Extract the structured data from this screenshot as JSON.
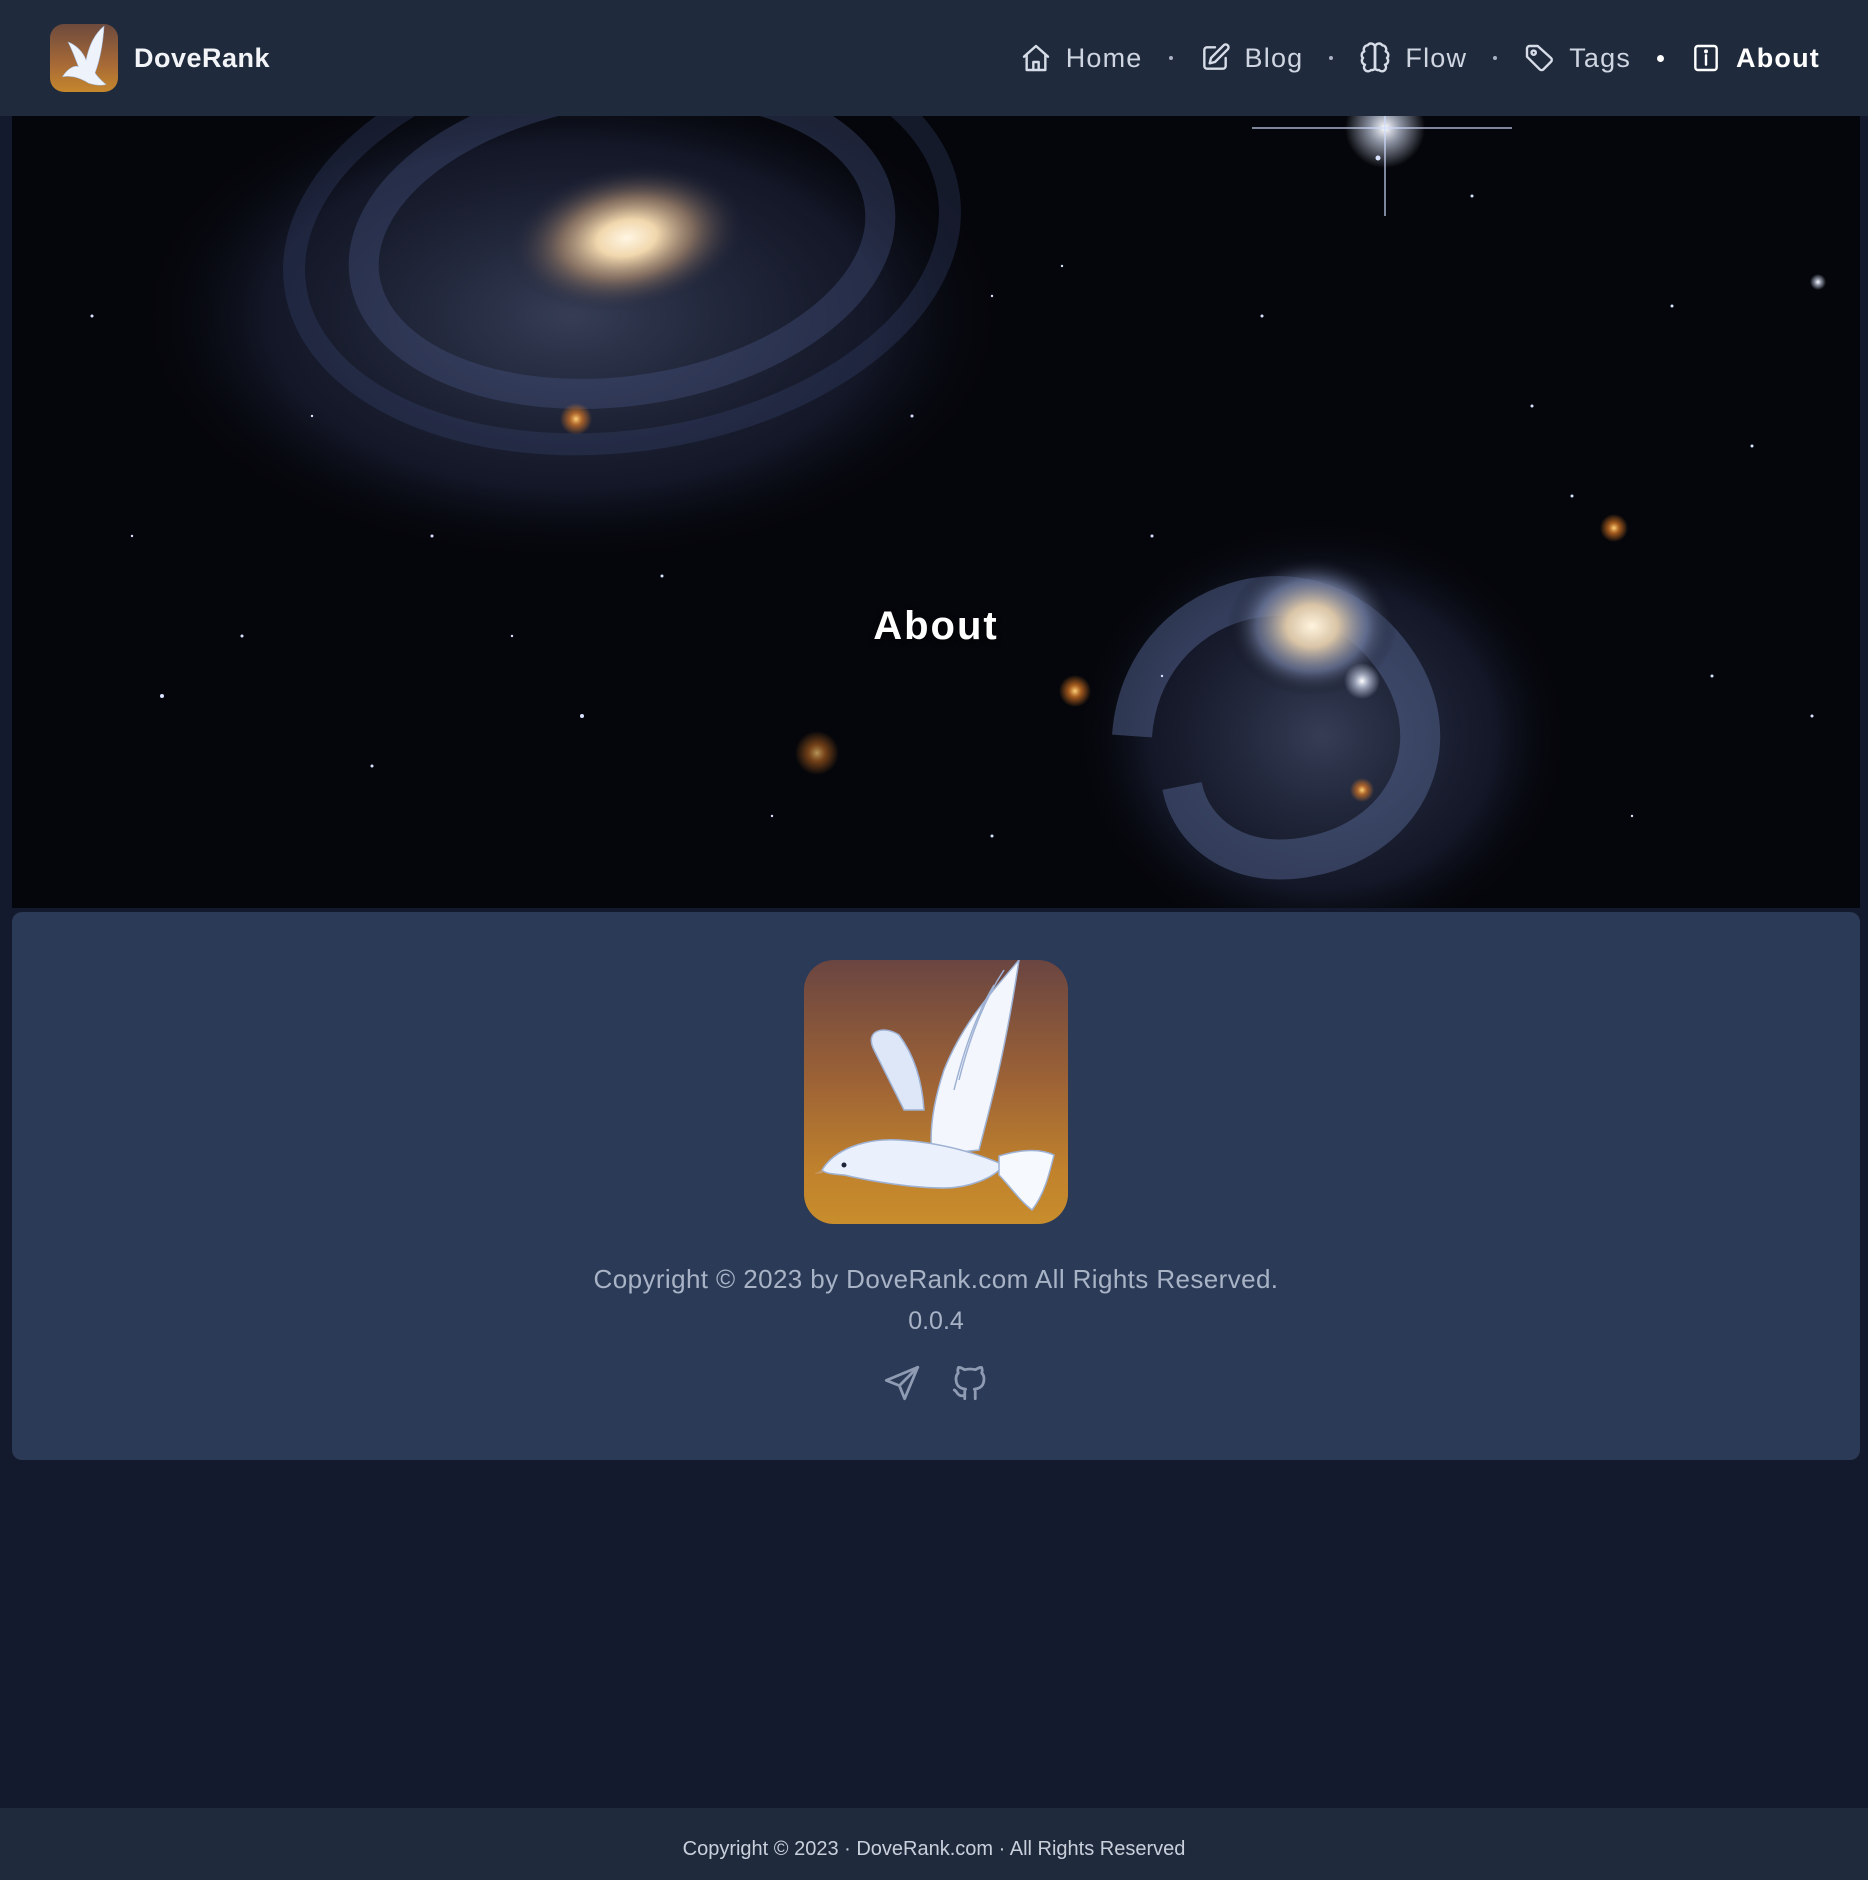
{
  "brand": {
    "name": "DoveRank",
    "logo_icon": "dove-logo"
  },
  "nav": {
    "items": [
      {
        "label": "Home",
        "icon": "home-icon",
        "active": false
      },
      {
        "label": "Blog",
        "icon": "edit-icon",
        "active": false
      },
      {
        "label": "Flow",
        "icon": "brain-icon",
        "active": false
      },
      {
        "label": "Tags",
        "icon": "tag-icon",
        "active": false
      },
      {
        "label": "About",
        "icon": "info-icon",
        "active": true
      }
    ]
  },
  "hero": {
    "title": "About",
    "image": "galaxies-image"
  },
  "card": {
    "logo_icon": "dove-logo",
    "copyright": "Copyright © 2023 by DoveRank.com All Rights Reserved.",
    "version": "0.0.4",
    "social": [
      {
        "icon": "send-icon"
      },
      {
        "icon": "github-icon"
      }
    ]
  },
  "footer": {
    "text": "Copyright © 2023 · DoveRank.com · All Rights Reserved"
  },
  "colors": {
    "header_bg": "#1f2a3c",
    "page_bg": "#131a2e",
    "card_bg": "#2b3a57",
    "logo_gradient_top": "#6a4541",
    "logo_gradient_bottom": "#c88d2c"
  }
}
